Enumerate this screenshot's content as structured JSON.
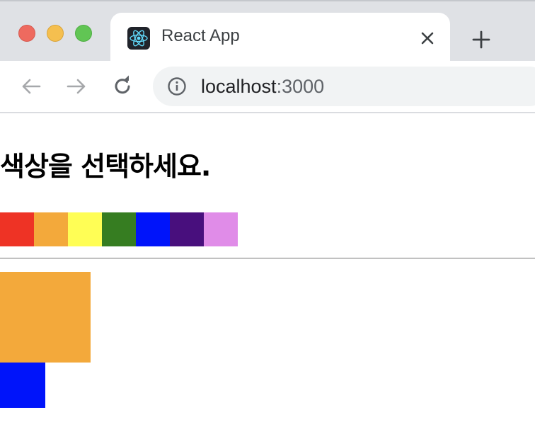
{
  "browser": {
    "tab": {
      "title": "React App",
      "favicon": "react-logo-icon"
    },
    "address": {
      "host": "localhost",
      "port": ":3000"
    }
  },
  "page": {
    "heading": "색상을 선택하세요.",
    "palette": [
      {
        "name": "red",
        "color": "#ee3325"
      },
      {
        "name": "orange",
        "color": "#f3a93b"
      },
      {
        "name": "yellow",
        "color": "#fffe55"
      },
      {
        "name": "green",
        "color": "#367d21"
      },
      {
        "name": "blue",
        "color": "#0014fa"
      },
      {
        "name": "indigo",
        "color": "#480f7d"
      },
      {
        "name": "violet",
        "color": "#e08ce8"
      }
    ],
    "selected_large_color": "#f3a93b",
    "selected_small_color": "#0014fa"
  }
}
